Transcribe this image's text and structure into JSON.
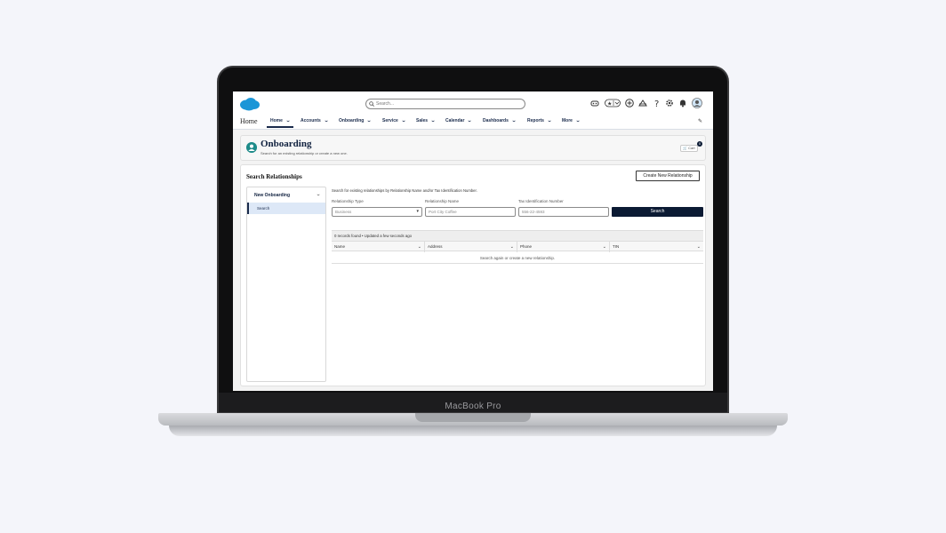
{
  "device": {
    "brand": "MacBook Pro"
  },
  "topbar": {
    "search_placeholder": "Search...",
    "icons": [
      "agent-icon",
      "favorites-icon",
      "add-icon",
      "trailhead-icon",
      "help-icon",
      "settings-icon",
      "notifications-icon",
      "user-avatar"
    ]
  },
  "nav": {
    "app_name": "Home",
    "items": [
      {
        "label": "Home",
        "active": true
      },
      {
        "label": "Accounts"
      },
      {
        "label": "Onboarding"
      },
      {
        "label": "Service"
      },
      {
        "label": "Sales"
      },
      {
        "label": "Calendar"
      },
      {
        "label": "Dashboards"
      },
      {
        "label": "Reports"
      },
      {
        "label": "More"
      }
    ]
  },
  "page_header": {
    "title": "Onboarding",
    "subtitle": "Search for an existing relationship or create a new one.",
    "cart_label": "Cart",
    "cart_count": "0"
  },
  "card": {
    "title": "Search Relationships",
    "create_button": "Create New Relationship"
  },
  "sidebar": {
    "heading": "New Onboarding",
    "items": [
      {
        "label": "Search"
      }
    ]
  },
  "form": {
    "hint": "Search for existing relationships by Relationship Name and/or Tax Identification Number.",
    "relationship_type": {
      "label": "Relationship Type",
      "placeholder": "Business"
    },
    "relationship_name": {
      "label": "Relationship Name",
      "placeholder": "Port City Coffee"
    },
    "tin": {
      "label": "Tax Identification Number",
      "placeholder": "556-22-4593"
    },
    "search_button": "Search"
  },
  "results": {
    "status": "0 records found • Updated a few seconds ago",
    "columns": [
      "Name",
      "Address",
      "Phone",
      "TIN"
    ],
    "empty_message": "Search again or create a new relationship."
  },
  "colors": {
    "brand_navy": "#0b1a33",
    "accent_teal": "#1f8c8a",
    "salesforce_blue": "#1b96d7"
  }
}
